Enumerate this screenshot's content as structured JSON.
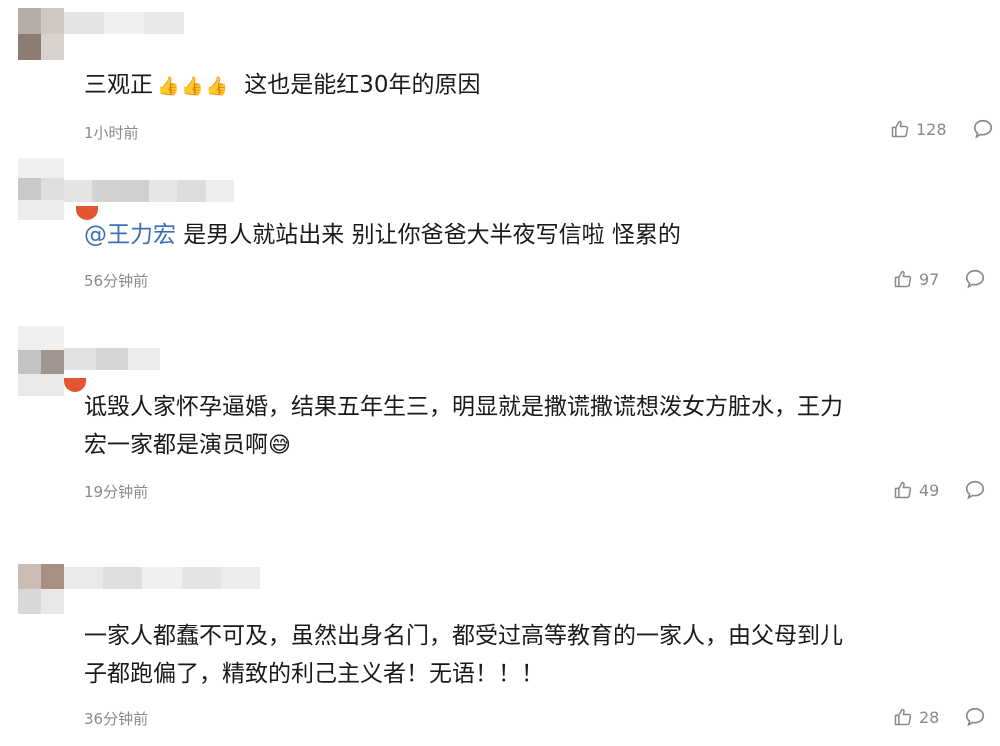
{
  "comments": [
    {
      "text_segments": [
        "三观正",
        "",
        "这也是能红30年的原因"
      ],
      "thumbs_emoji": "👍👍👍",
      "time": "1小时前",
      "likes": "128"
    },
    {
      "mention": "@王力宏",
      "text": " 是男人就站出来 别让你爸爸大半夜写信啦 怪累的",
      "time": "56分钟前",
      "likes": "97"
    },
    {
      "line1": "诋毁人家怀孕逼婚，结果五年生三，明显就是撒谎撒谎想泼女方脏水，王力",
      "line2": "宏一家都是演员啊",
      "emoji": "😅",
      "time": "19分钟前",
      "likes": "49"
    },
    {
      "line1": "一家人都蠢不可及，虽然出身名门，都受过高等教育的一家人，由父母到儿",
      "line2": "子都跑偏了，精致的利己主义者！无语！！！",
      "time": "36分钟前",
      "likes": "28"
    }
  ],
  "icons": {
    "like": "thumbs-up-outline-icon",
    "reply": "comment-bubble-icon"
  },
  "colors": {
    "mention": "#3b6fb6",
    "meta_text": "#8a8a8a",
    "body_text": "#1a1a1a"
  }
}
